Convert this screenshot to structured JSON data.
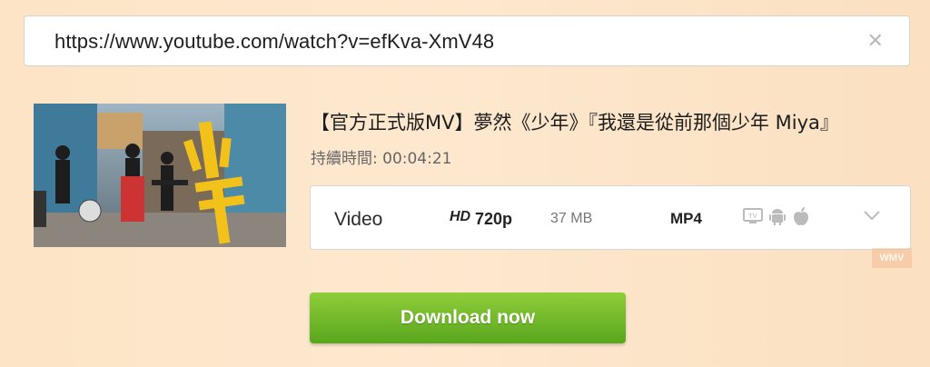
{
  "search": {
    "url": "https://www.youtube.com/watch?v=efKva-XmV48",
    "clear_icon": "close-icon"
  },
  "video": {
    "title": "【官方正式版MV】夢然《少年》『我還是從前那個少年 Miya』",
    "duration_label": "持續時間: 00:04:21",
    "thumbnail_text": "少年"
  },
  "format": {
    "type": "Video",
    "hd_badge": "HD",
    "resolution": "720p",
    "size": "37 MB",
    "container": "MP4",
    "device_icons": [
      "tv-icon",
      "android-icon",
      "apple-icon"
    ],
    "dropdown_icon": "chevron-down-icon"
  },
  "download": {
    "label": "Download now",
    "color": "#6cb52a"
  },
  "watermark": {
    "text": "WMV"
  }
}
